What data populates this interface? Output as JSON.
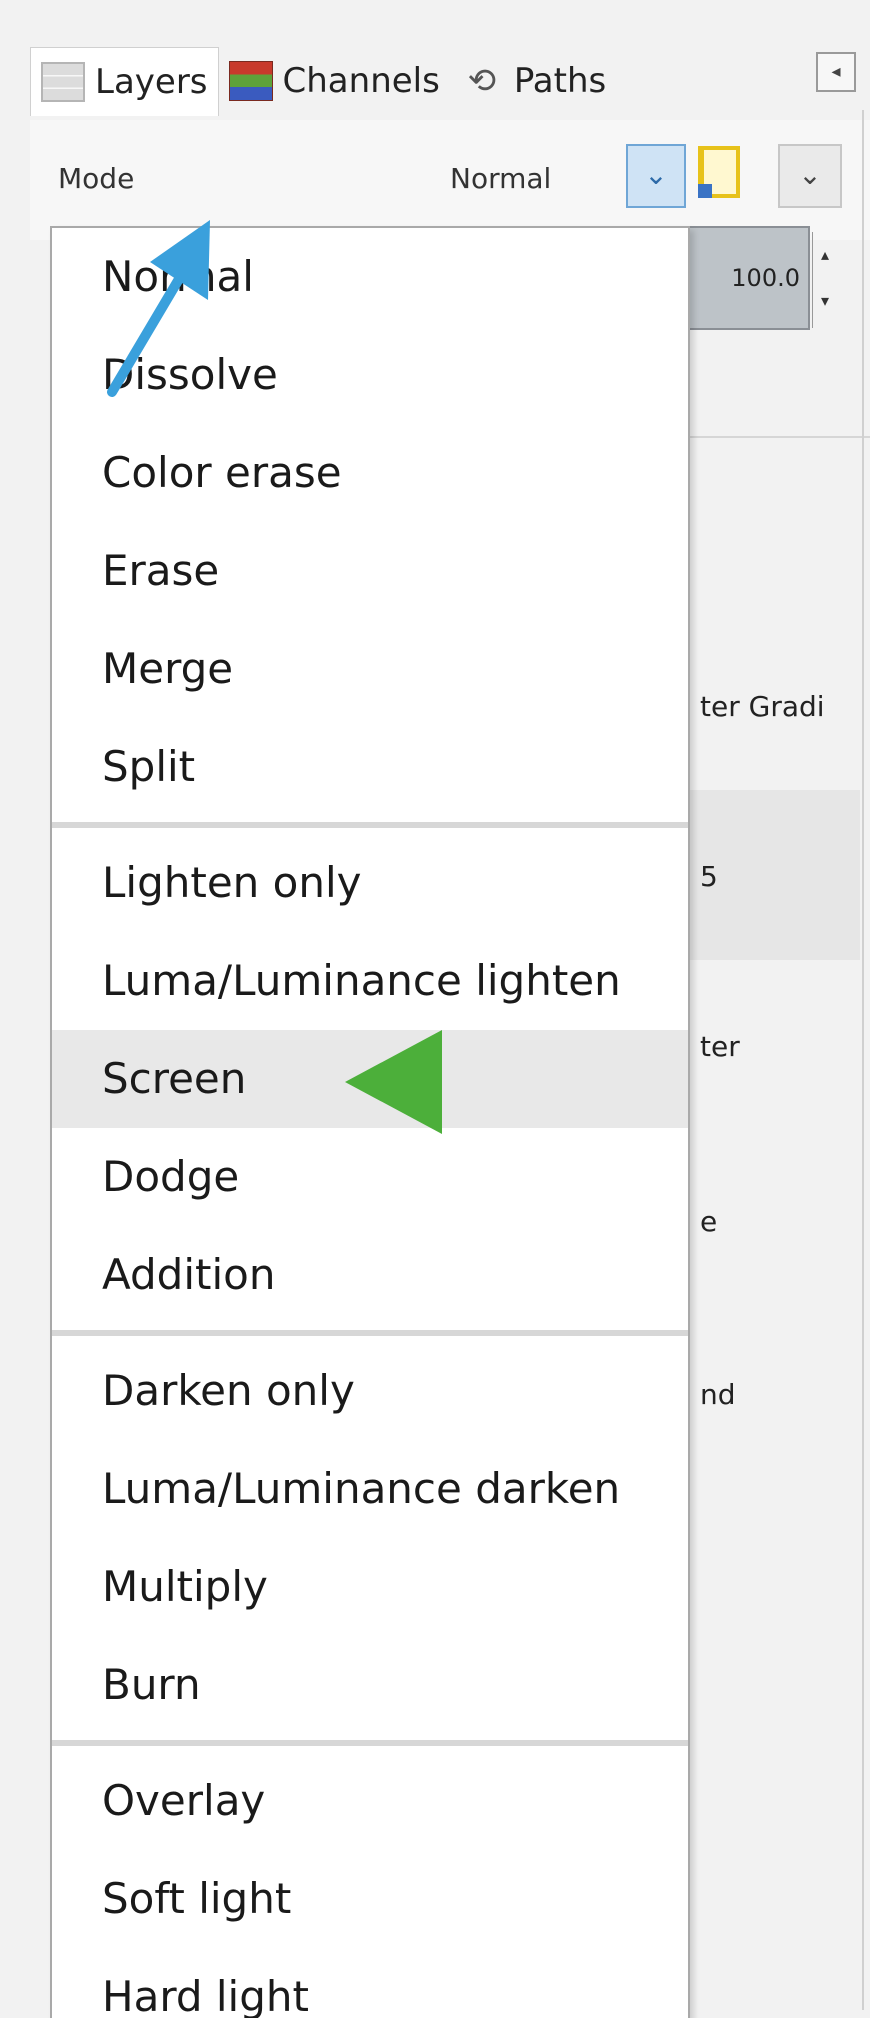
{
  "tabs": [
    {
      "label": "Layers",
      "icon": "layers-icon",
      "active": true
    },
    {
      "label": "Channels",
      "icon": "channels-icon",
      "active": false
    },
    {
      "label": "Paths",
      "icon": "paths-icon",
      "active": false
    }
  ],
  "panel_menu_icon": "◂",
  "mode_row": {
    "label": "Mode",
    "value": "Normal",
    "dropdown_icon": "⌄",
    "comp_dropdown_icon": "⌄"
  },
  "opacity": {
    "value": "100.0",
    "spinner_up": "▴",
    "spinner_down": "▾"
  },
  "partial_layer_texts": [
    "ter Gradi",
    "5",
    "ter",
    "e",
    "nd"
  ],
  "menu": {
    "groups": [
      [
        "Normal",
        "Dissolve",
        "Color erase",
        "Erase",
        "Merge",
        "Split"
      ],
      [
        "Lighten only",
        "Luma/Luminance lighten",
        "Screen",
        "Dodge",
        "Addition"
      ],
      [
        "Darken only",
        "Luma/Luminance darken",
        "Multiply",
        "Burn"
      ],
      [
        "Overlay",
        "Soft light",
        "Hard light"
      ]
    ],
    "highlighted": "Screen"
  },
  "annotations": {
    "blue_arrow_color": "#3aa0dc",
    "green_arrow_color": "#4caf3a"
  }
}
